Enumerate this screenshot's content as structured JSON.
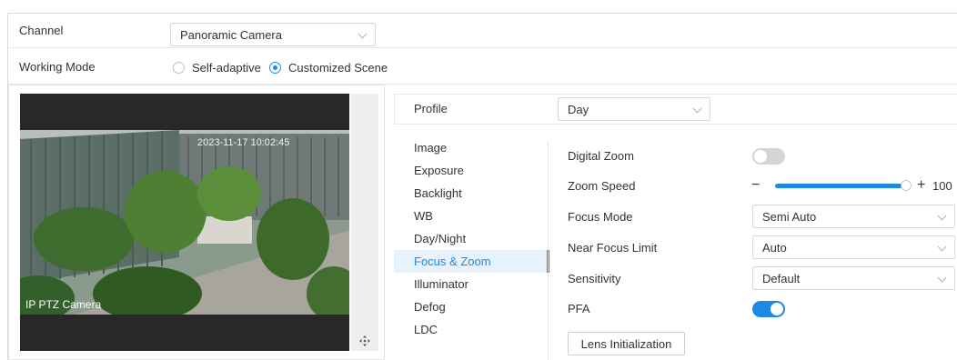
{
  "channel": {
    "label": "Channel",
    "value": "Panoramic Camera"
  },
  "working_mode": {
    "label": "Working Mode",
    "options": [
      {
        "label": "Self-adaptive",
        "selected": false
      },
      {
        "label": "Customized Scene",
        "selected": true
      }
    ]
  },
  "preview": {
    "osd_text": "IP PTZ Camera",
    "timestamp": "2023-11-17 10:02:45"
  },
  "profile": {
    "label": "Profile",
    "value": "Day"
  },
  "menu": {
    "items": [
      {
        "label": "Image",
        "active": false
      },
      {
        "label": "Exposure",
        "active": false
      },
      {
        "label": "Backlight",
        "active": false
      },
      {
        "label": "WB",
        "active": false
      },
      {
        "label": "Day/Night",
        "active": false
      },
      {
        "label": "Focus & Zoom",
        "active": true
      },
      {
        "label": "Illuminator",
        "active": false
      },
      {
        "label": "Defog",
        "active": false
      },
      {
        "label": "LDC",
        "active": false
      }
    ]
  },
  "settings": {
    "digital_zoom": {
      "label": "Digital Zoom",
      "enabled": false
    },
    "zoom_speed": {
      "label": "Zoom Speed",
      "value": "100",
      "minus": "−",
      "plus": "+"
    },
    "focus_mode": {
      "label": "Focus Mode",
      "value": "Semi Auto"
    },
    "near_focus_limit": {
      "label": "Near Focus Limit",
      "value": "Auto"
    },
    "sensitivity": {
      "label": "Sensitivity",
      "value": "Default"
    },
    "pfa": {
      "label": "PFA",
      "enabled": true
    },
    "lens_init_button": "Lens Initialization"
  },
  "colors": {
    "accent": "#1e88e5",
    "toggle_off": "#d5d5d5",
    "active_bg": "#e8f2fc"
  }
}
